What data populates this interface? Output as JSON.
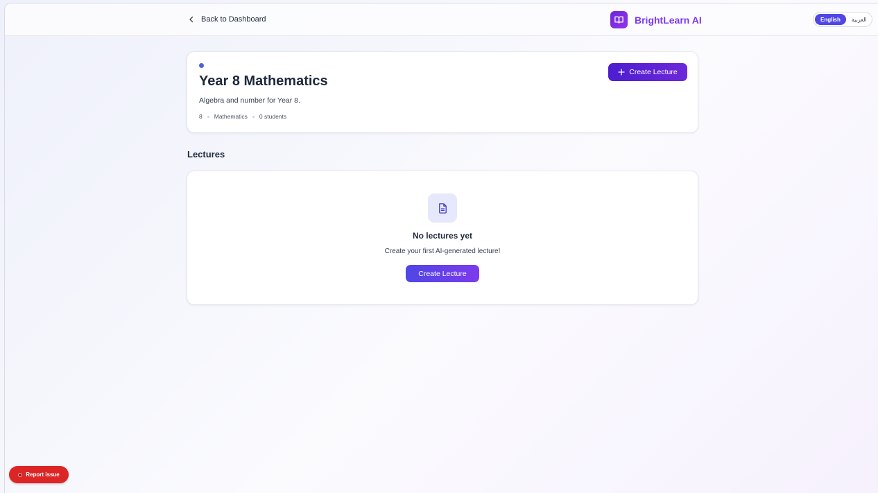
{
  "header": {
    "back_label": "Back to Dashboard",
    "brand_name": "BrightLearn AI",
    "languages": [
      {
        "label": "English",
        "active": true
      },
      {
        "label": "العربية",
        "active": false
      }
    ]
  },
  "course": {
    "title": "Year 8 Mathematics",
    "description": "Algebra and number for Year 8.",
    "meta": {
      "grade": "8",
      "subject": "Mathematics",
      "students": "0 students"
    },
    "create_button_label": "Create Lecture"
  },
  "lectures": {
    "heading": "Lectures",
    "empty_title": "No lectures yet",
    "empty_subtitle": "Create your first AI-generated lecture!",
    "empty_button_label": "Create Lecture"
  },
  "report_issue_label": "Report issue",
  "colors": {
    "accent": "#4f46e5",
    "brand": "#7c3aed",
    "danger": "#dc2626"
  }
}
